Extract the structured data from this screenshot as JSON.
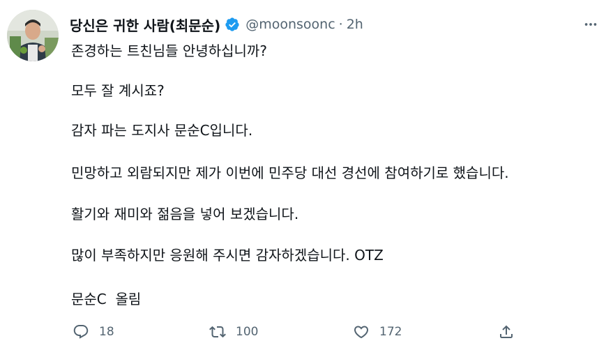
{
  "tweet": {
    "author_name": "당신은 귀한 사람(최문순)",
    "handle": "@moonsoonc",
    "separator": "·",
    "time": "2h",
    "paragraphs": [
      "존경하는 트친님들 안녕하십니까?",
      "모두 잘 계시죠?",
      "감자 파는 도지사 문순C입니다.",
      "민망하고 외람되지만 제가 이번에 민주당 대선 경선에 참여하기로 했습니다.",
      "활기와 재미와 젊음을 넣어 보겠습니다.",
      "많이 부족하지만 응원해 주시면 감자하겠습니다. OTZ",
      "문순C  올림"
    ],
    "actions": {
      "reply_count": "18",
      "retweet_count": "100",
      "like_count": "172"
    }
  },
  "icons": {
    "verified": "verified-badge-icon",
    "more": "more-options-icon",
    "reply": "reply-icon",
    "retweet": "retweet-icon",
    "like": "heart-icon",
    "share": "share-icon"
  },
  "colors": {
    "text": "#0f1419",
    "secondary": "#536471",
    "verified": "#1d9bf0",
    "background": "#ffffff"
  }
}
